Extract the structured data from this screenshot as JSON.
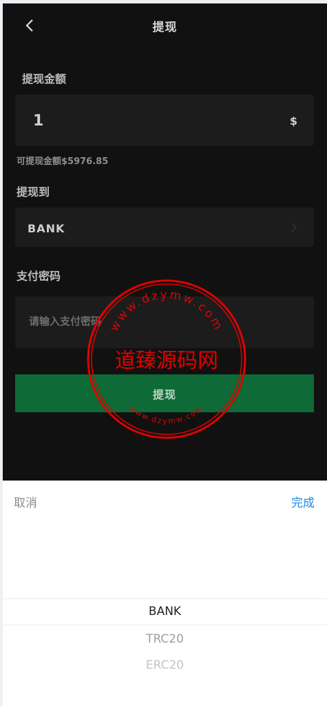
{
  "header": {
    "title": "提现"
  },
  "amount": {
    "label": "提现金额",
    "value": "1",
    "currency": "$",
    "available": "可提现金额$5976.85"
  },
  "method": {
    "label": "提现到",
    "value": "BANK"
  },
  "password": {
    "label": "支付密码",
    "placeholder": "请输入支付密码"
  },
  "submit": {
    "label": "提现"
  },
  "watermark": {
    "text": "道臻源码网",
    "top_arc": "www.dzymw.com",
    "bottom_arc": "www.dzymw.com"
  },
  "sheet": {
    "cancel": "取消",
    "done": "完成",
    "options": [
      {
        "label": "BANK",
        "color": "#222222"
      },
      {
        "label": "TRC20",
        "color": "#9e9e9e"
      },
      {
        "label": "ERC20",
        "color": "#c4c4c4"
      }
    ]
  },
  "colors": {
    "accent_green": "#0e6a36",
    "link_blue": "#1e88e5",
    "stamp_red": "#e10000"
  }
}
